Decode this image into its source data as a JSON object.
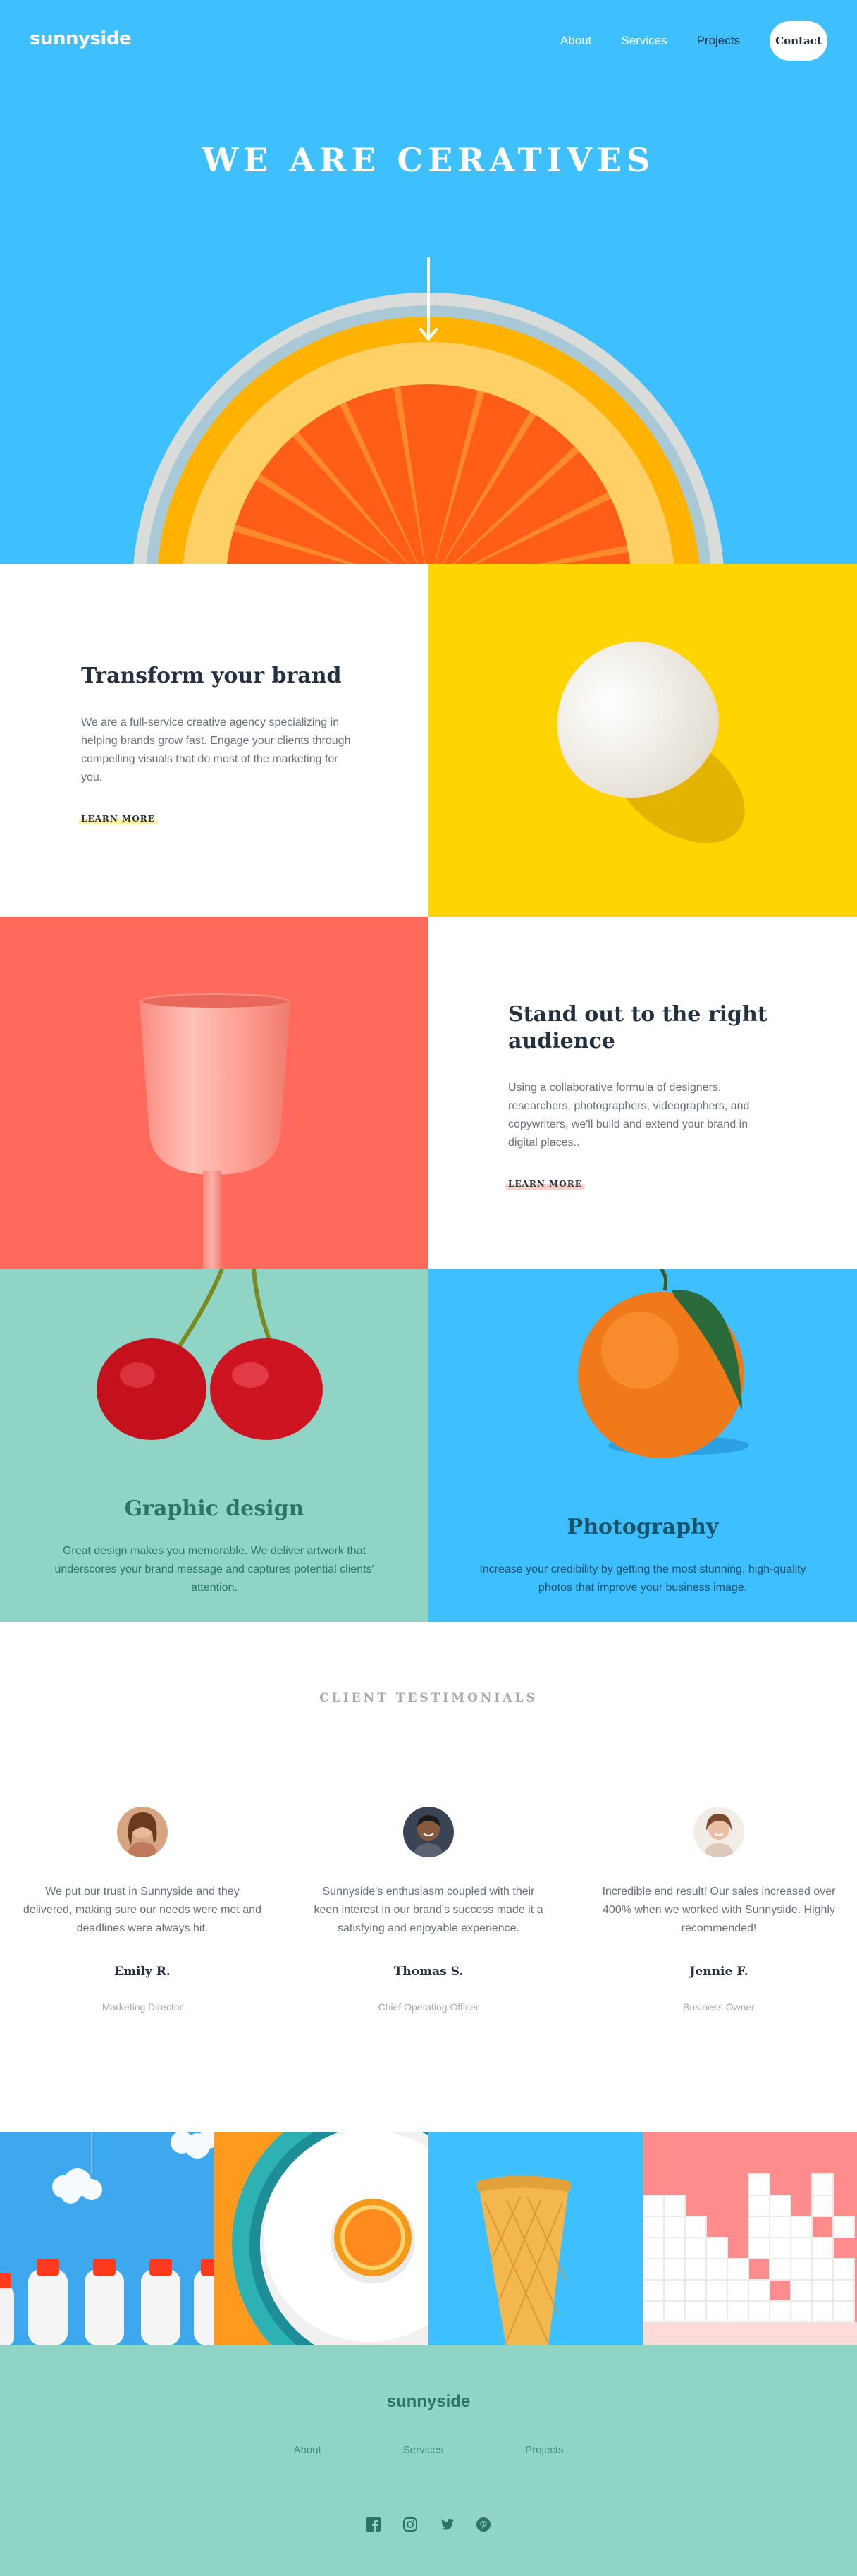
{
  "nav": {
    "logo": "sunnyside",
    "links": [
      "About",
      "Services",
      "Projects"
    ],
    "contact": "Contact"
  },
  "hero": {
    "title": "WE ARE CERATIVES"
  },
  "features": [
    {
      "title": "Transform your brand",
      "text": "We are a full-service creative agency specializing in helping brands grow fast. Engage your clients through compelling visuals that do most of the marketing for you.",
      "link": "LEARN MORE"
    },
    {
      "title": "Stand out to the right audience",
      "text": "Using a collaborative formula of designers, researchers, photographers, videographers, and copywriters, we'll build and extend your brand in digital places..",
      "link": "LEARN MORE"
    }
  ],
  "services": [
    {
      "title": "Graphic design",
      "text": "Great design makes you memorable. We deliver artwork that underscores your brand message and captures potential clients' attention."
    },
    {
      "title": "Photography",
      "text": "Increase your credibility by getting the most stunning, high-quality photos that improve your business image."
    }
  ],
  "testimonials": {
    "heading": "CLIENT TESTIMONIALS",
    "items": [
      {
        "quote": "We put our trust in Sunnyside and they delivered, making sure our needs were met and deadlines were always hit.",
        "name": "Emily R.",
        "role": "Marketing Director"
      },
      {
        "quote": "Sunnyside's enthusiasm coupled with their keen interest in our brand's success made it a satisfying and enjoyable experience.",
        "name": "Thomas S.",
        "role": "Chief Operating Officer"
      },
      {
        "quote": "Incredible end result! Our sales increased over 400% when we worked with Sunnyside. Highly recommended!",
        "name": "Jennie F.",
        "role": "Business Owner"
      }
    ]
  },
  "footer": {
    "logo": "sunnyside",
    "links": [
      "About",
      "Services",
      "Projects"
    ],
    "social": [
      "facebook-icon",
      "instagram-icon",
      "twitter-icon",
      "pinterest-icon"
    ]
  },
  "colors": {
    "sky": "#3ebfff",
    "yellow": "#ffd400",
    "coral": "#ff6a5c",
    "teal": "#90d4c5",
    "dark": "#23303e"
  }
}
